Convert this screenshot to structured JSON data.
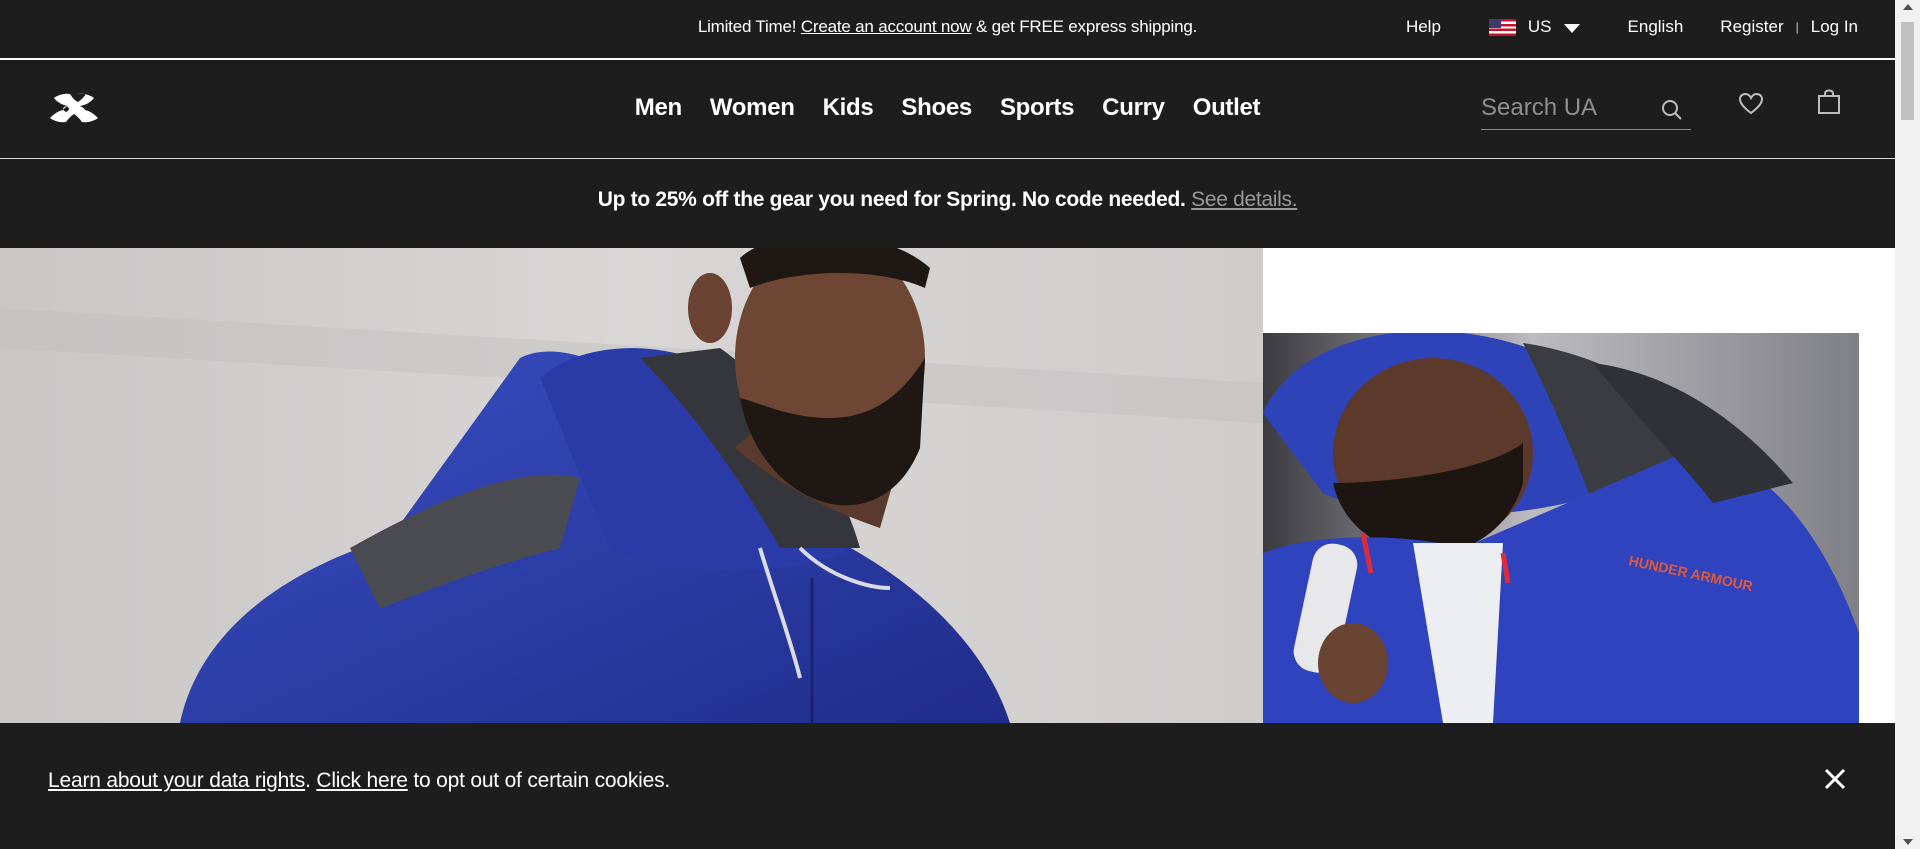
{
  "utility_bar": {
    "promo_prefix": "Limited Time! ",
    "promo_link": "Create an account now",
    "promo_suffix": " & get FREE express shipping.",
    "help": "Help",
    "country": "US",
    "language": "English",
    "register": "Register",
    "separator": "|",
    "login": "Log In"
  },
  "nav": {
    "items": [
      "Men",
      "Women",
      "Kids",
      "Shoes",
      "Sports",
      "Curry",
      "Outlet"
    ],
    "search_placeholder": "Search UA",
    "icons": [
      "search-icon",
      "heart-icon",
      "bag-icon"
    ]
  },
  "sale_banner": {
    "text": "Up to 25% off the gear you need for Spring. No code needed. ",
    "link": "See details."
  },
  "cookie_bar": {
    "link1": "Learn about your data rights",
    "between": ". ",
    "link2": "Click here",
    "suffix": " to opt out of certain cookies."
  },
  "colors": {
    "background": "#1d1d1d",
    "text": "#ffffff",
    "muted_link": "#9a9a9a",
    "hoodie_blue": "#2d3ea0"
  }
}
